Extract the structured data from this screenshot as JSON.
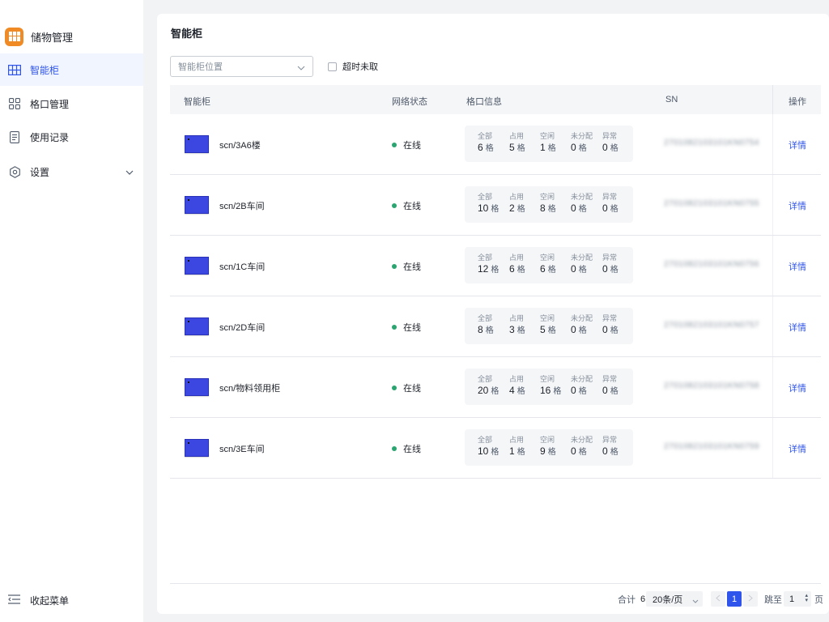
{
  "sidebar": {
    "brand": "储物管理",
    "items": [
      {
        "label": "智能柜",
        "icon": "cabinet-grid-icon",
        "active": true
      },
      {
        "label": "格口管理",
        "icon": "grid-four-icon",
        "active": false
      },
      {
        "label": "使用记录",
        "icon": "document-list-icon",
        "active": false
      },
      {
        "label": "设置",
        "icon": "gear-hex-icon",
        "active": false
      }
    ],
    "collapse_label": "收起菜单"
  },
  "page": {
    "title": "智能柜",
    "filter_placeholder": "智能柜位置",
    "timeout_label": "超时未取"
  },
  "table": {
    "headers": {
      "cabinet": "智能柜",
      "network": "网络状态",
      "slots": "格口信息",
      "sn": "SN",
      "ops": "操作"
    },
    "slot_labels": [
      "全部",
      "占用",
      "空闲",
      "未分配",
      "异常"
    ],
    "slot_unit": "格",
    "detail_label": "详情",
    "rows": [
      {
        "name": "scn/3A6楼",
        "status": "在线",
        "slots": [
          "6",
          "5",
          "1",
          "0",
          "0"
        ],
        "sn": "2701082103101KN0754"
      },
      {
        "name": "scn/2B车间",
        "status": "在线",
        "slots": [
          "10",
          "2",
          "8",
          "0",
          "0"
        ],
        "sn": "2701082103101KN0755"
      },
      {
        "name": "scn/1C车间",
        "status": "在线",
        "slots": [
          "12",
          "6",
          "6",
          "0",
          "0"
        ],
        "sn": "2701082103101KN0756"
      },
      {
        "name": "scn/2D车间",
        "status": "在线",
        "slots": [
          "8",
          "3",
          "5",
          "0",
          "0"
        ],
        "sn": "2701082103101KN0757"
      },
      {
        "name": "scn/物料领用柜",
        "status": "在线",
        "slots": [
          "20",
          "4",
          "16",
          "0",
          "0"
        ],
        "sn": "2701082103101KN0758"
      },
      {
        "name": "scn/3E车间",
        "status": "在线",
        "slots": [
          "10",
          "1",
          "9",
          "0",
          "0"
        ],
        "sn": "2701082103101KN0759"
      }
    ]
  },
  "pagination": {
    "total_label": "合计",
    "total": "6",
    "page_size": "20条/页",
    "current_page": "1",
    "jump_label": "跳至",
    "jump_value": "1",
    "page_unit": "页"
  },
  "colors": {
    "accent": "#2f54eb",
    "brand": "#f08a24",
    "online": "#2ba471"
  }
}
